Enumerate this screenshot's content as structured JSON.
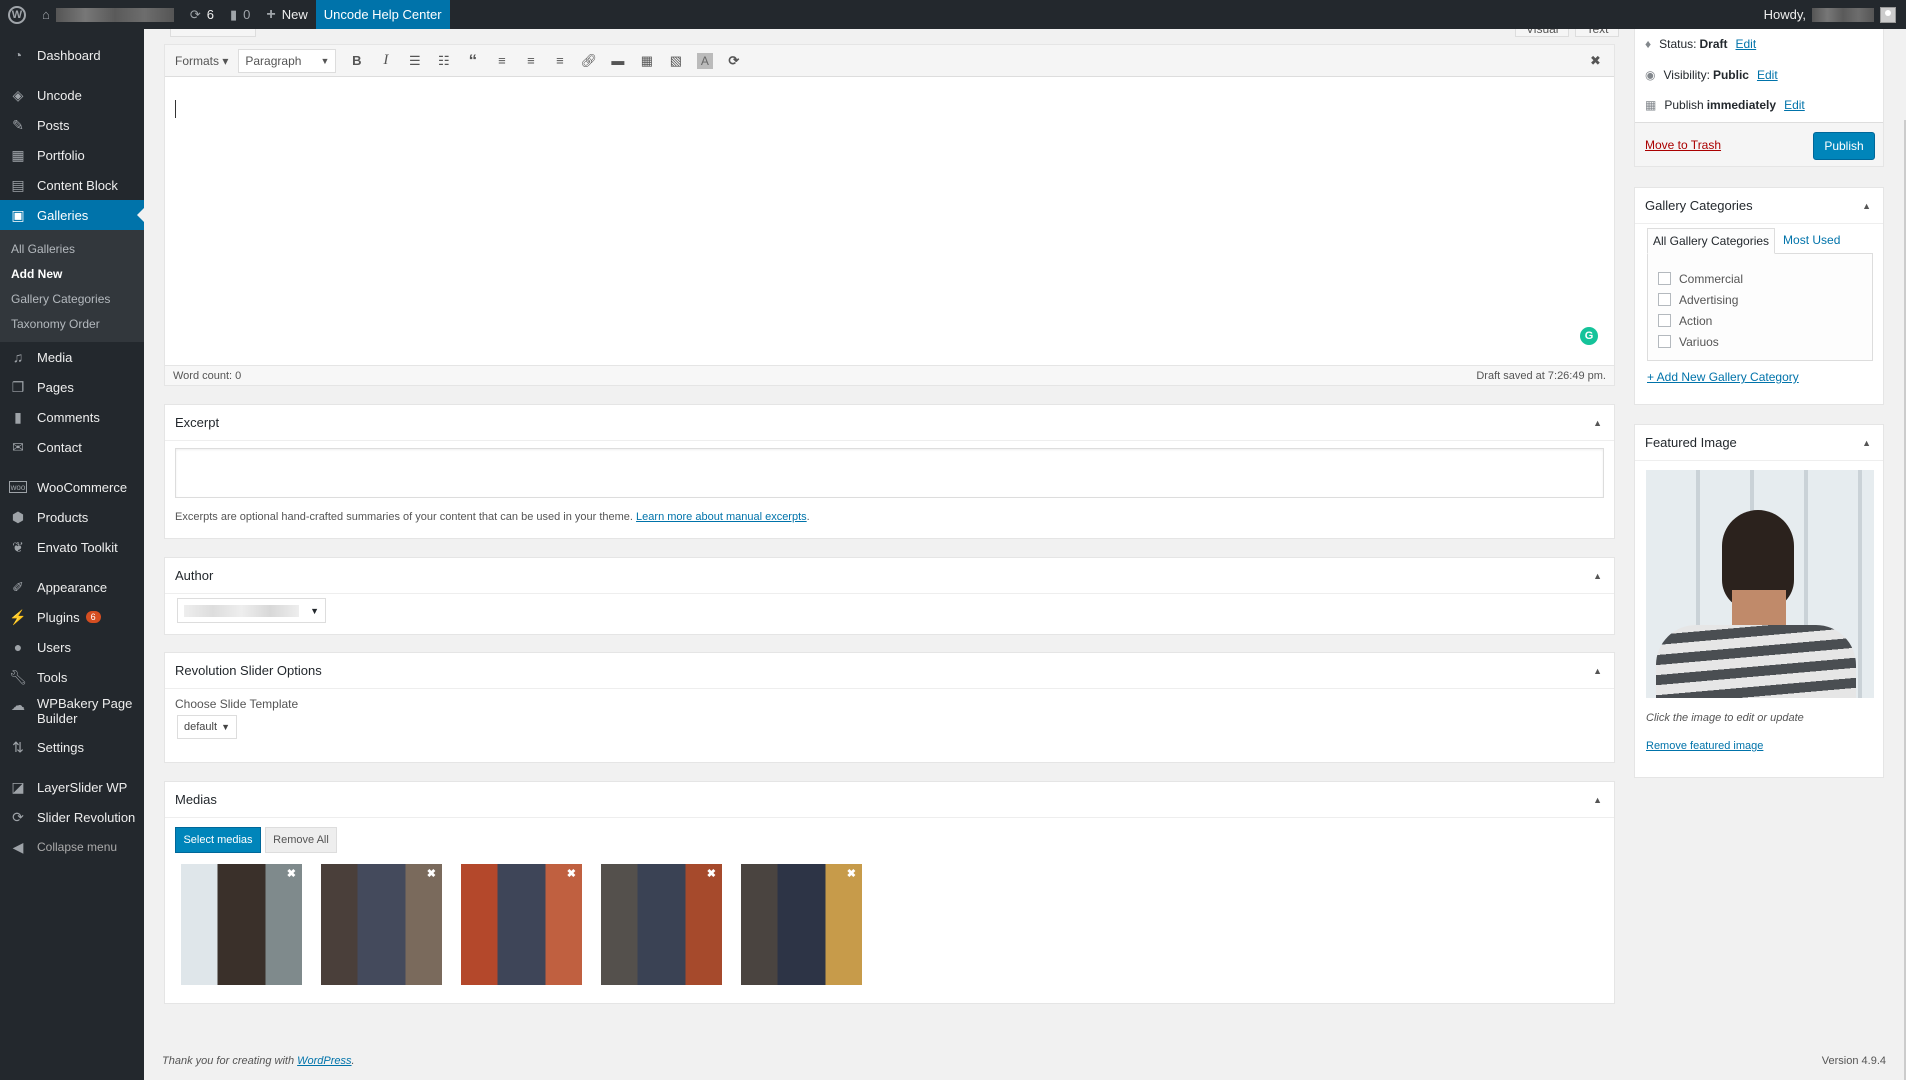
{
  "admin_bar": {
    "updates_count": "6",
    "comments_count": "0",
    "new_label": "New",
    "help_center_label": "Uncode Help Center",
    "howdy_label": "Howdy,"
  },
  "sidebar": {
    "items": [
      {
        "label": "Dashboard",
        "icon": "dashboard-icon"
      },
      {
        "label": "Uncode",
        "icon": "layers-icon"
      },
      {
        "label": "Posts",
        "icon": "pin-icon"
      },
      {
        "label": "Portfolio",
        "icon": "portfolio-icon"
      },
      {
        "label": "Content Block",
        "icon": "block-icon"
      },
      {
        "label": "Galleries",
        "icon": "gallery-icon"
      },
      {
        "label": "Media",
        "icon": "media-icon"
      },
      {
        "label": "Pages",
        "icon": "pages-icon"
      },
      {
        "label": "Comments",
        "icon": "comment-icon"
      },
      {
        "label": "Contact",
        "icon": "mail-icon"
      },
      {
        "label": "WooCommerce",
        "icon": "woo-icon"
      },
      {
        "label": "Products",
        "icon": "box-icon"
      },
      {
        "label": "Envato Toolkit",
        "icon": "leaf-icon"
      },
      {
        "label": "Appearance",
        "icon": "brush-icon"
      },
      {
        "label": "Plugins",
        "icon": "plug-icon",
        "badge": "6"
      },
      {
        "label": "Users",
        "icon": "user-icon"
      },
      {
        "label": "Tools",
        "icon": "wrench-icon"
      },
      {
        "label": "WPBakery Page Builder",
        "icon": "cloud-icon"
      },
      {
        "label": "Settings",
        "icon": "settings-icon"
      },
      {
        "label": "LayerSlider WP",
        "icon": "slides-icon"
      },
      {
        "label": "Slider Revolution",
        "icon": "refresh-icon"
      },
      {
        "label": "Collapse menu",
        "icon": "collapse-icon"
      }
    ],
    "submenu": [
      "All Galleries",
      "Add New",
      "Gallery Categories",
      "Taxonomy Order"
    ]
  },
  "editor": {
    "tabs": [
      "Visual",
      "Text"
    ],
    "formats_label": "Formats",
    "paragraph_label": "Paragraph",
    "word_count": "Word count: 0",
    "draft_saved": "Draft saved at 7:26:49 pm."
  },
  "excerpt": {
    "title": "Excerpt",
    "value": "",
    "help_text": "Excerpts are optional hand-crafted summaries of your content that can be used in your theme.",
    "help_link": "Learn more about manual excerpts"
  },
  "author": {
    "title": "Author"
  },
  "revslider": {
    "title": "Revolution Slider Options",
    "label": "Choose Slide Template",
    "value": "default"
  },
  "medias": {
    "title": "Medias",
    "select_label": "Select medias",
    "remove_all_label": "Remove All",
    "thumbs": [
      {
        "name": "man-facing-wall",
        "colors": [
          "#dfe6ea",
          "#3a302a",
          "#7f8a8c"
        ]
      },
      {
        "name": "man-with-phone-door",
        "colors": [
          "#4a3f3a",
          "#444a5c",
          "#7a6a5c"
        ]
      },
      {
        "name": "man-phone-brick",
        "colors": [
          "#b4482b",
          "#3e4558",
          "#c06040"
        ]
      },
      {
        "name": "man-glasses-brick",
        "colors": [
          "#54504c",
          "#3a4254",
          "#a64a2c"
        ]
      },
      {
        "name": "man-parking-sign",
        "colors": [
          "#4a4440",
          "#2d3446",
          "#c79b4a"
        ]
      }
    ]
  },
  "publish": {
    "status_label": "Status:",
    "status_value": "Draft",
    "visibility_label": "Visibility:",
    "visibility_value": "Public",
    "publish_label": "Publish",
    "publish_value": "immediately",
    "edit_label": "Edit",
    "trash_label": "Move to Trash",
    "publish_button": "Publish"
  },
  "gallery_categories": {
    "title": "Gallery Categories",
    "tabs": [
      "All Gallery Categories",
      "Most Used"
    ],
    "items": [
      "Commercial",
      "Advertising",
      "Action",
      "Variuos"
    ],
    "add_new": "+ Add New Gallery Category"
  },
  "featured_image": {
    "title": "Featured Image",
    "hint": "Click the image to edit or update",
    "remove": "Remove featured image"
  },
  "footer": {
    "thanks_text": "Thank you for creating with",
    "thanks_link": "WordPress",
    "version": "Version 4.9.4"
  }
}
